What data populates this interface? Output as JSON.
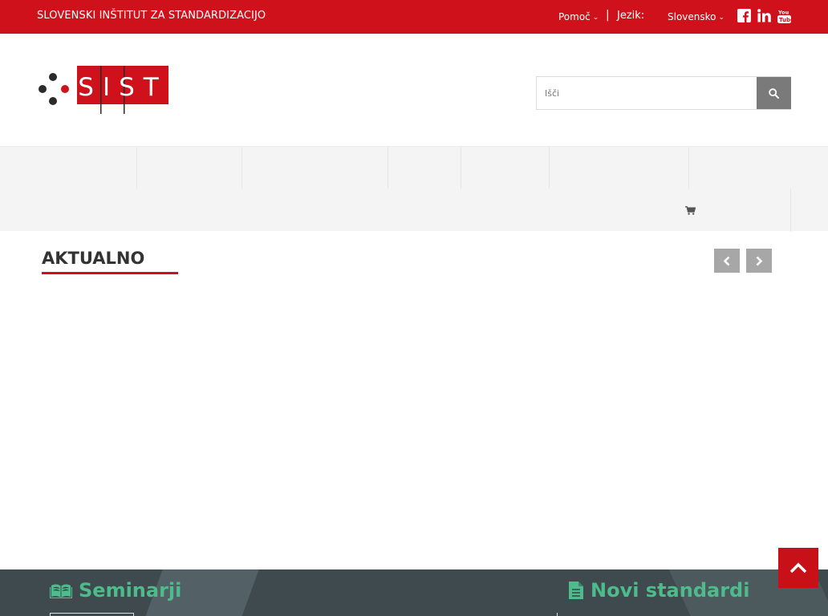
{
  "topbar": {
    "org_name": "SLOVENSKI INŠTITUT ZA STANDARDIZACIJO",
    "help_label": "Pomoč",
    "separator": "|",
    "language_label": "Jezik:",
    "language_selected": "Slovensko",
    "social": [
      "facebook-icon",
      "linkedin-icon",
      "youtube-icon"
    ]
  },
  "logo": {
    "text": "SIST"
  },
  "search": {
    "placeholder": "Išči"
  },
  "section": {
    "title": "AKTUALNO"
  },
  "footer": {
    "seminars_title": "Seminarji",
    "standards_title": "Novi standardi"
  },
  "colors": {
    "brand_red": "#cf111b",
    "accent_green": "#4dbb8b",
    "band_dark": "#3f4a4e",
    "arrow_grey": "#a7a7a7"
  }
}
